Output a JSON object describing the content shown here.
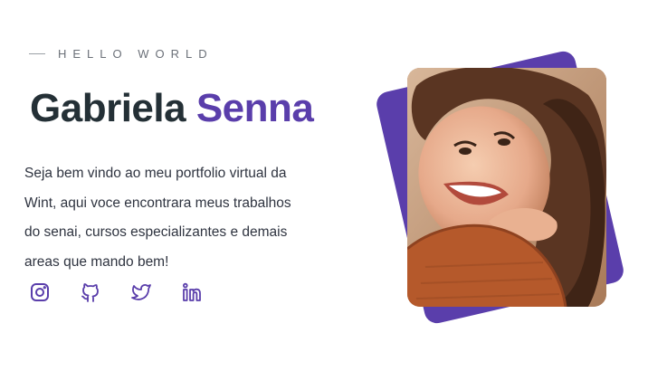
{
  "hero": {
    "eyebrow": "HELLO WORLD",
    "first_name": "Gabriela",
    "last_name": "Senna",
    "intro_lines": [
      "Seja bem vindo ao meu portfolio virtual da",
      "Wint, aqui voce encontrara meus trabalhos",
      "do senai, cursos especializantes e demais",
      "areas que mando bem!"
    ]
  },
  "socials": [
    {
      "icon": "instagram-icon"
    },
    {
      "icon": "github-icon"
    },
    {
      "icon": "twitter-icon"
    },
    {
      "icon": "linkedin-icon"
    }
  ],
  "colors": {
    "accent": "#5a3eab",
    "heading": "#243036",
    "text": "#2f3440",
    "muted": "#6b7078"
  }
}
